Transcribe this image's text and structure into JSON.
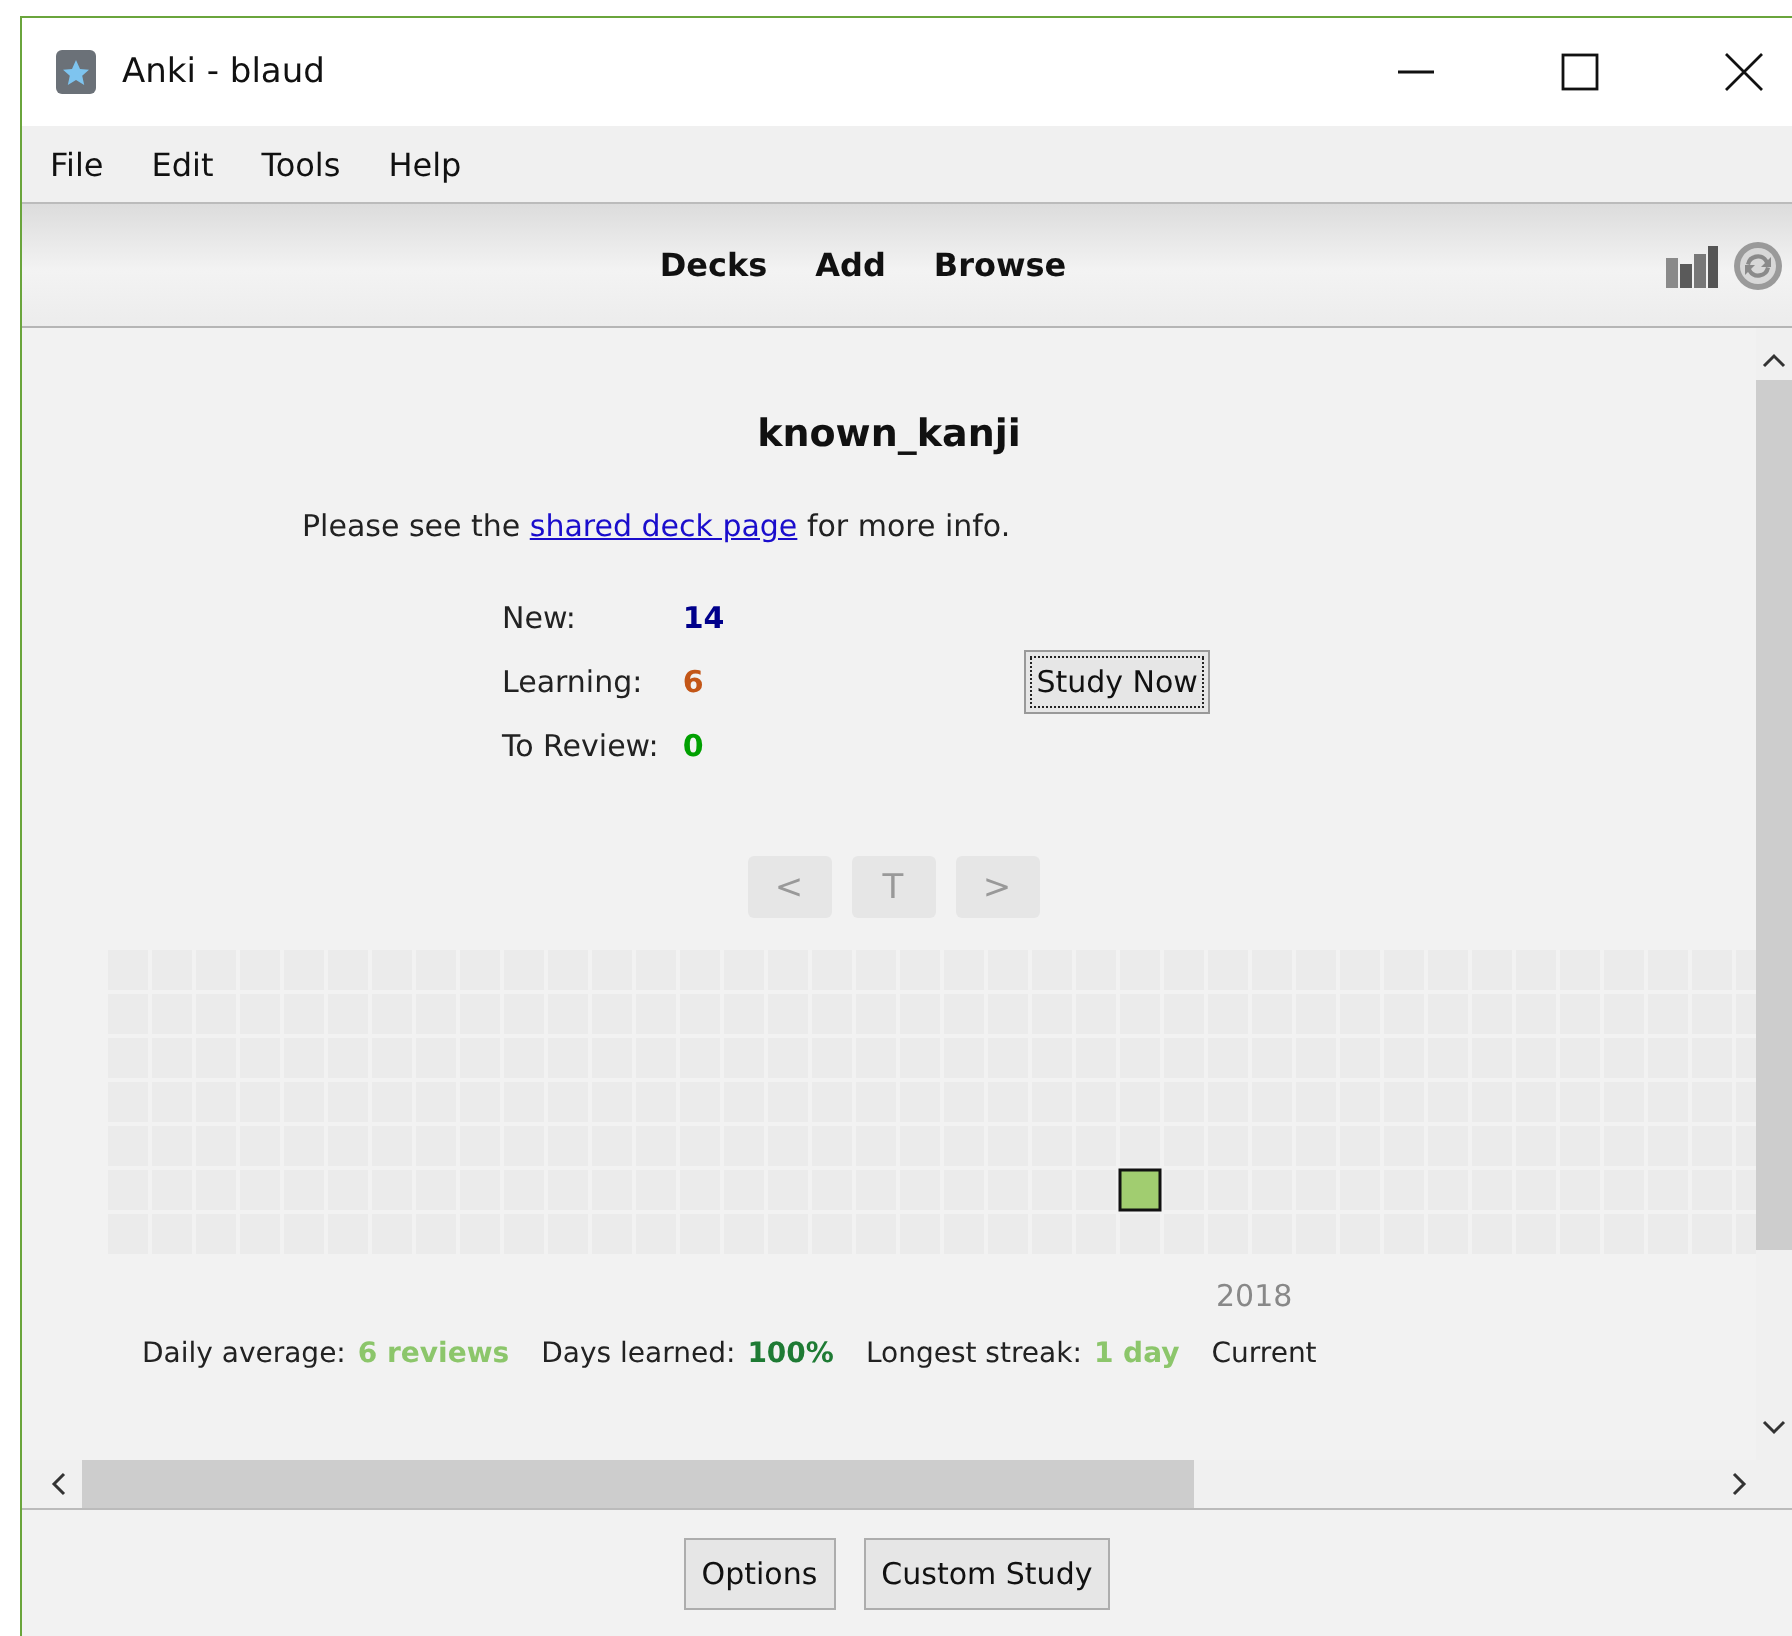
{
  "window": {
    "title": "Anki - blaud"
  },
  "menu": [
    {
      "label": "File"
    },
    {
      "label": "Edit"
    },
    {
      "label": "Tools"
    },
    {
      "label": "Help"
    }
  ],
  "toolbar": {
    "links": [
      "Decks",
      "Add",
      "Browse"
    ]
  },
  "deck": {
    "title": "known_kanji",
    "description": {
      "before": "Please see the",
      "link": "shared deck page",
      "after": "for more info."
    },
    "counts": [
      {
        "label": "New:",
        "value": "14",
        "color": "#00008b"
      },
      {
        "label": "Learning:",
        "value": "6",
        "color": "#c35617"
      },
      {
        "label": "To Review:",
        "value": "0",
        "color": "#00a000"
      }
    ],
    "study_button": "Study Now"
  },
  "heatmap": {
    "nav": [
      "<",
      "T",
      ">"
    ],
    "year_label": "2018",
    "stats": [
      {
        "label": "Daily average:",
        "value": "6 reviews",
        "color": "#8cc66b"
      },
      {
        "label": "Days learned:",
        "value": "100%",
        "color": "#1e7b34"
      },
      {
        "label": "Longest streak:",
        "value": "1 day",
        "color": "#8cc66b"
      },
      {
        "label": "Current"
      }
    ]
  },
  "bottom_buttons": [
    "Options",
    "Custom Study"
  ]
}
